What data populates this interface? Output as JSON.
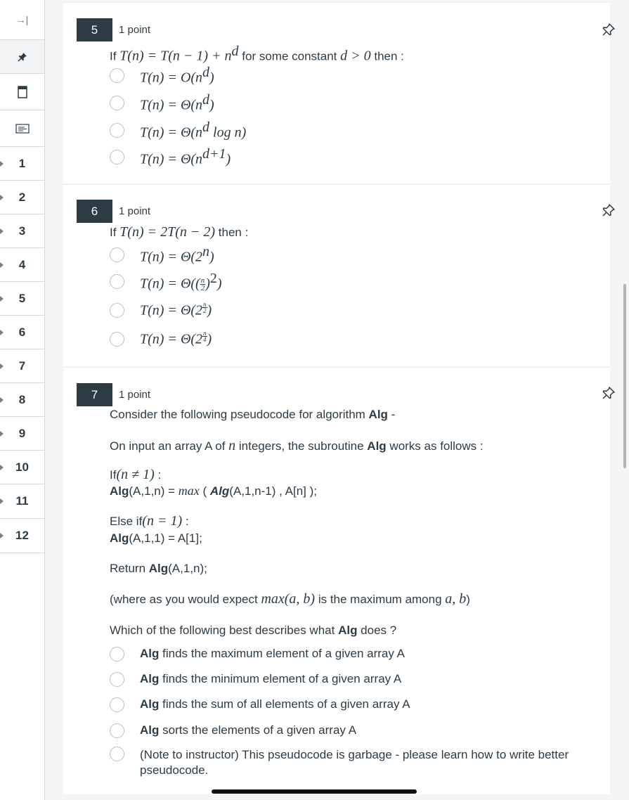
{
  "sidebar": {
    "collapse_glyph": "→|",
    "numbers": [
      "1",
      "2",
      "3",
      "4",
      "5",
      "6",
      "7",
      "8",
      "9",
      "10",
      "11",
      "12"
    ]
  },
  "questions": [
    {
      "number": "5",
      "points": "1 point",
      "prompt_prefix": "If ",
      "prompt_math": "T(n) = T(n − 1) + n",
      "prompt_sup": "d",
      "prompt_mid": " for some constant ",
      "prompt_math2": "d > 0",
      "prompt_suffix": " then :",
      "options": [
        {
          "base": "T(n) = O(n",
          "sup": "d",
          "tail": ")"
        },
        {
          "base": "T(n) = Θ(n",
          "sup": "d",
          "tail": ")"
        },
        {
          "base": "T(n) = Θ(n",
          "sup": "d",
          "tail": " log n)"
        },
        {
          "base": "T(n) = Θ(n",
          "sup": "d+1",
          "tail": ")"
        }
      ]
    },
    {
      "number": "6",
      "points": "1 point",
      "prompt_prefix": "If ",
      "prompt_math": "T(n) = 2T(n − 2)",
      "prompt_suffix": " then :",
      "options": [
        {
          "base": "T(n) = Θ(2",
          "sup": "n",
          "tail": ")"
        },
        {
          "base": "T(n) = Θ((",
          "frac_n": "n",
          "frac_d": "2",
          "tail2": ")",
          "sup": "2",
          "tail": ")"
        },
        {
          "base": "T(n) = Θ(2",
          "frac_n": "n",
          "frac_d": "2",
          "tail": ")"
        },
        {
          "base": "T(n) = Θ(2",
          "frac_n": "n",
          "frac_d": "4",
          "tail": ")"
        }
      ]
    },
    {
      "number": "7",
      "points": "1 point",
      "line1_text": "Consider the following pseudocode for algorithm ",
      "line1_bold": "Alg",
      "line1_end": " -",
      "line2_a": "On input an array A of ",
      "line2_math": "n",
      "line2_b": " integers, the subroutine ",
      "line2_bold": "Alg",
      "line2_c": " works as follows :",
      "if_a": "If",
      "if_math": "(n ≠ 1)",
      "if_b": " :",
      "rec_bold": "Alg",
      "rec_a": "(A,1,n) = ",
      "rec_math": "max",
      "rec_b": " ( ",
      "rec_bold2": "Alg",
      "rec_c": "(A,1,n-1) , A[n] );",
      "else_a": "Else if",
      "else_math": "(n = 1)",
      "else_b": " :",
      "base_bold": "Alg",
      "base_a": "(A,1,1) = A[1];",
      "ret_a": "Return ",
      "ret_bold": "Alg",
      "ret_b": "(A,1,n);",
      "where_a": "(where as you would expect ",
      "where_math": "max(a, b)",
      "where_b": " is the maximum among ",
      "where_math2": "a, b",
      "where_c": ")",
      "which_a": "Which of the following best describes what ",
      "which_bold": "Alg",
      "which_b": " does ?",
      "options": [
        {
          "bold": "Alg",
          "text": " finds the maximum element of a given array A"
        },
        {
          "bold": "Alg",
          "text": " finds the minimum element of a given array A"
        },
        {
          "bold": "Alg",
          "text": " finds the sum of all elements of a given array A"
        },
        {
          "bold": "Alg",
          "text": " sorts the elements of a given array A"
        },
        {
          "bold": "",
          "text": "(Note to instructor) This pseudocode is garbage - please learn how to write better",
          "text2": "pseudocode."
        }
      ]
    }
  ]
}
